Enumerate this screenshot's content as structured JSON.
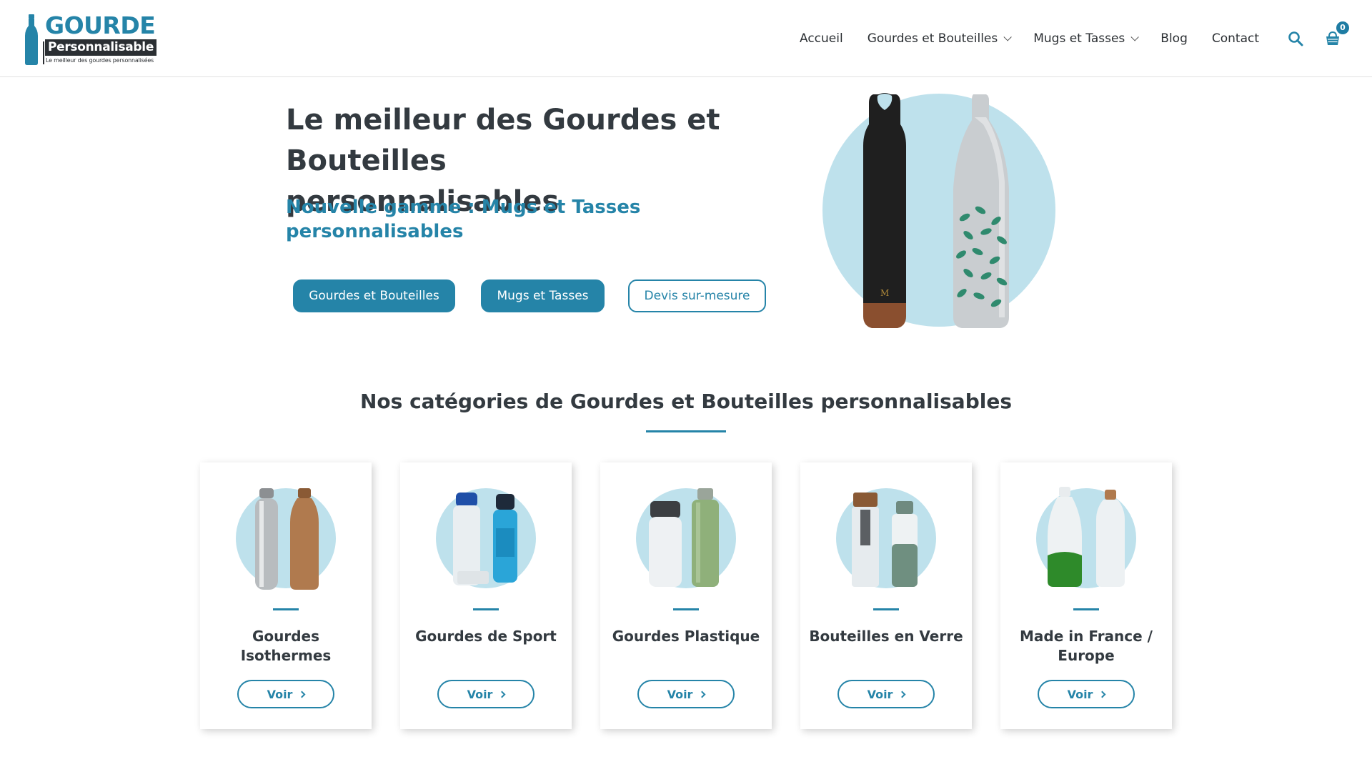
{
  "logo": {
    "word": "GOURDE",
    "sub": "Personnalisable",
    "tagline": "Le meilleur des gourdes personnalisées"
  },
  "nav": {
    "items": [
      {
        "label": "Accueil"
      },
      {
        "label": "Gourdes et Bouteilles"
      },
      {
        "label": "Mugs et Tasses"
      },
      {
        "label": "Blog"
      },
      {
        "label": "Contact"
      }
    ],
    "cart_count": "0",
    "icons": [
      "search-icon",
      "cart-icon"
    ]
  },
  "hero": {
    "title": "Le meilleur des Gourdes et Bouteilles personnalisables",
    "subtitle": "Nouvelle gamme : Mugs et Tasses personnalisables",
    "buttons": [
      {
        "label": "Gourdes et Bouteilles"
      },
      {
        "label": "Mugs et Tasses"
      },
      {
        "label": "Devis sur-mesure"
      }
    ]
  },
  "categories": {
    "title": "Nos catégories de Gourdes et Bouteilles personnalisables",
    "items": [
      {
        "title": "Gourdes Isothermes",
        "button": "Voir"
      },
      {
        "title": "Gourdes de Sport",
        "button": "Voir"
      },
      {
        "title": "Gourdes Plastique",
        "button": "Voir"
      },
      {
        "title": "Bouteilles en Verre",
        "button": "Voir"
      },
      {
        "title": "Made in France / Europe",
        "button": "Voir"
      }
    ]
  },
  "colors": {
    "accent": "#2584a8",
    "circle": "#bee1ec",
    "text_dark": "#333a40"
  }
}
